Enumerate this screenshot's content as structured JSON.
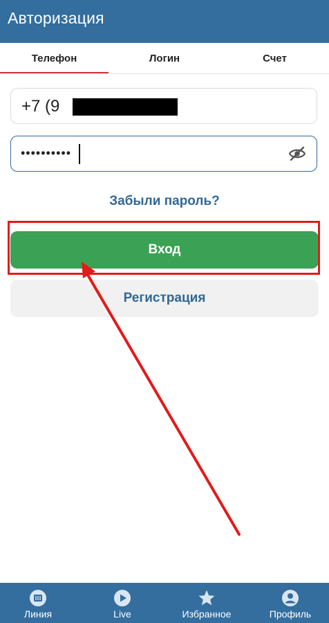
{
  "header": {
    "title": "Авторизация"
  },
  "tabs": [
    {
      "label": "Телефон",
      "active": true
    },
    {
      "label": "Логин",
      "active": false
    },
    {
      "label": "Счет",
      "active": false
    }
  ],
  "form": {
    "phone_value": "+7 (9",
    "password_value": "••••••••••",
    "forgot_link": "Забыли пароль?",
    "login_button": "Вход",
    "register_button": "Регистрация"
  },
  "bottom_nav": [
    {
      "label": "Линия",
      "icon": "calendar-icon"
    },
    {
      "label": "Live",
      "icon": "play-icon"
    },
    {
      "label": "Избранное",
      "icon": "star-icon"
    },
    {
      "label": "Профиль",
      "icon": "profile-icon"
    }
  ],
  "colors": {
    "primary": "#336e9f",
    "tab_indicator": "#d2323a",
    "login_button": "#3ba255",
    "annotation": "#e41a1a",
    "link": "#2f6895"
  }
}
